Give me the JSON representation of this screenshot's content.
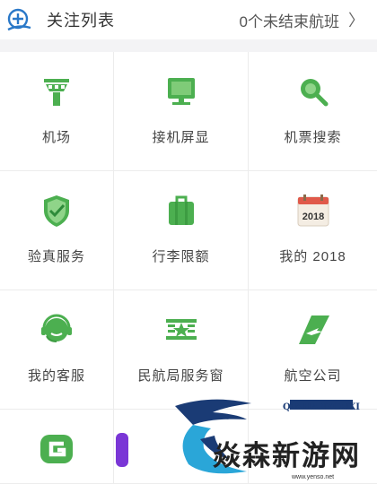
{
  "header": {
    "title": "关注列表",
    "status": "0个未结束航班",
    "chevron": "〉"
  },
  "grid_items": [
    {
      "label": "机场",
      "icon": "control-tower-icon"
    },
    {
      "label": "接机屏显",
      "icon": "monitor-icon"
    },
    {
      "label": "机票搜索",
      "icon": "magnifier-icon"
    },
    {
      "label": "验真服务",
      "icon": "shield-check-icon"
    },
    {
      "label": "行李限额",
      "icon": "luggage-icon"
    },
    {
      "label": "我的 2018",
      "icon": "calendar-icon",
      "badge": "2018"
    },
    {
      "label": "我的客服",
      "icon": "headset-icon"
    },
    {
      "label": "民航局服务窗",
      "icon": "caac-emblem-icon"
    },
    {
      "label": "航空公司",
      "icon": "airline-tail-icon"
    },
    {
      "label": "",
      "icon": "g-logo-icon"
    },
    {
      "label": "",
      "icon": "purple-app-icon"
    },
    {
      "label": "",
      "icon": ""
    }
  ],
  "watermark": {
    "name": "焱森新游网",
    "en": "QINHANYOUXI",
    "url": "www.yenso.net"
  },
  "colors": {
    "accent": "#4caf50",
    "text": "#444444",
    "divider": "#ececec"
  }
}
